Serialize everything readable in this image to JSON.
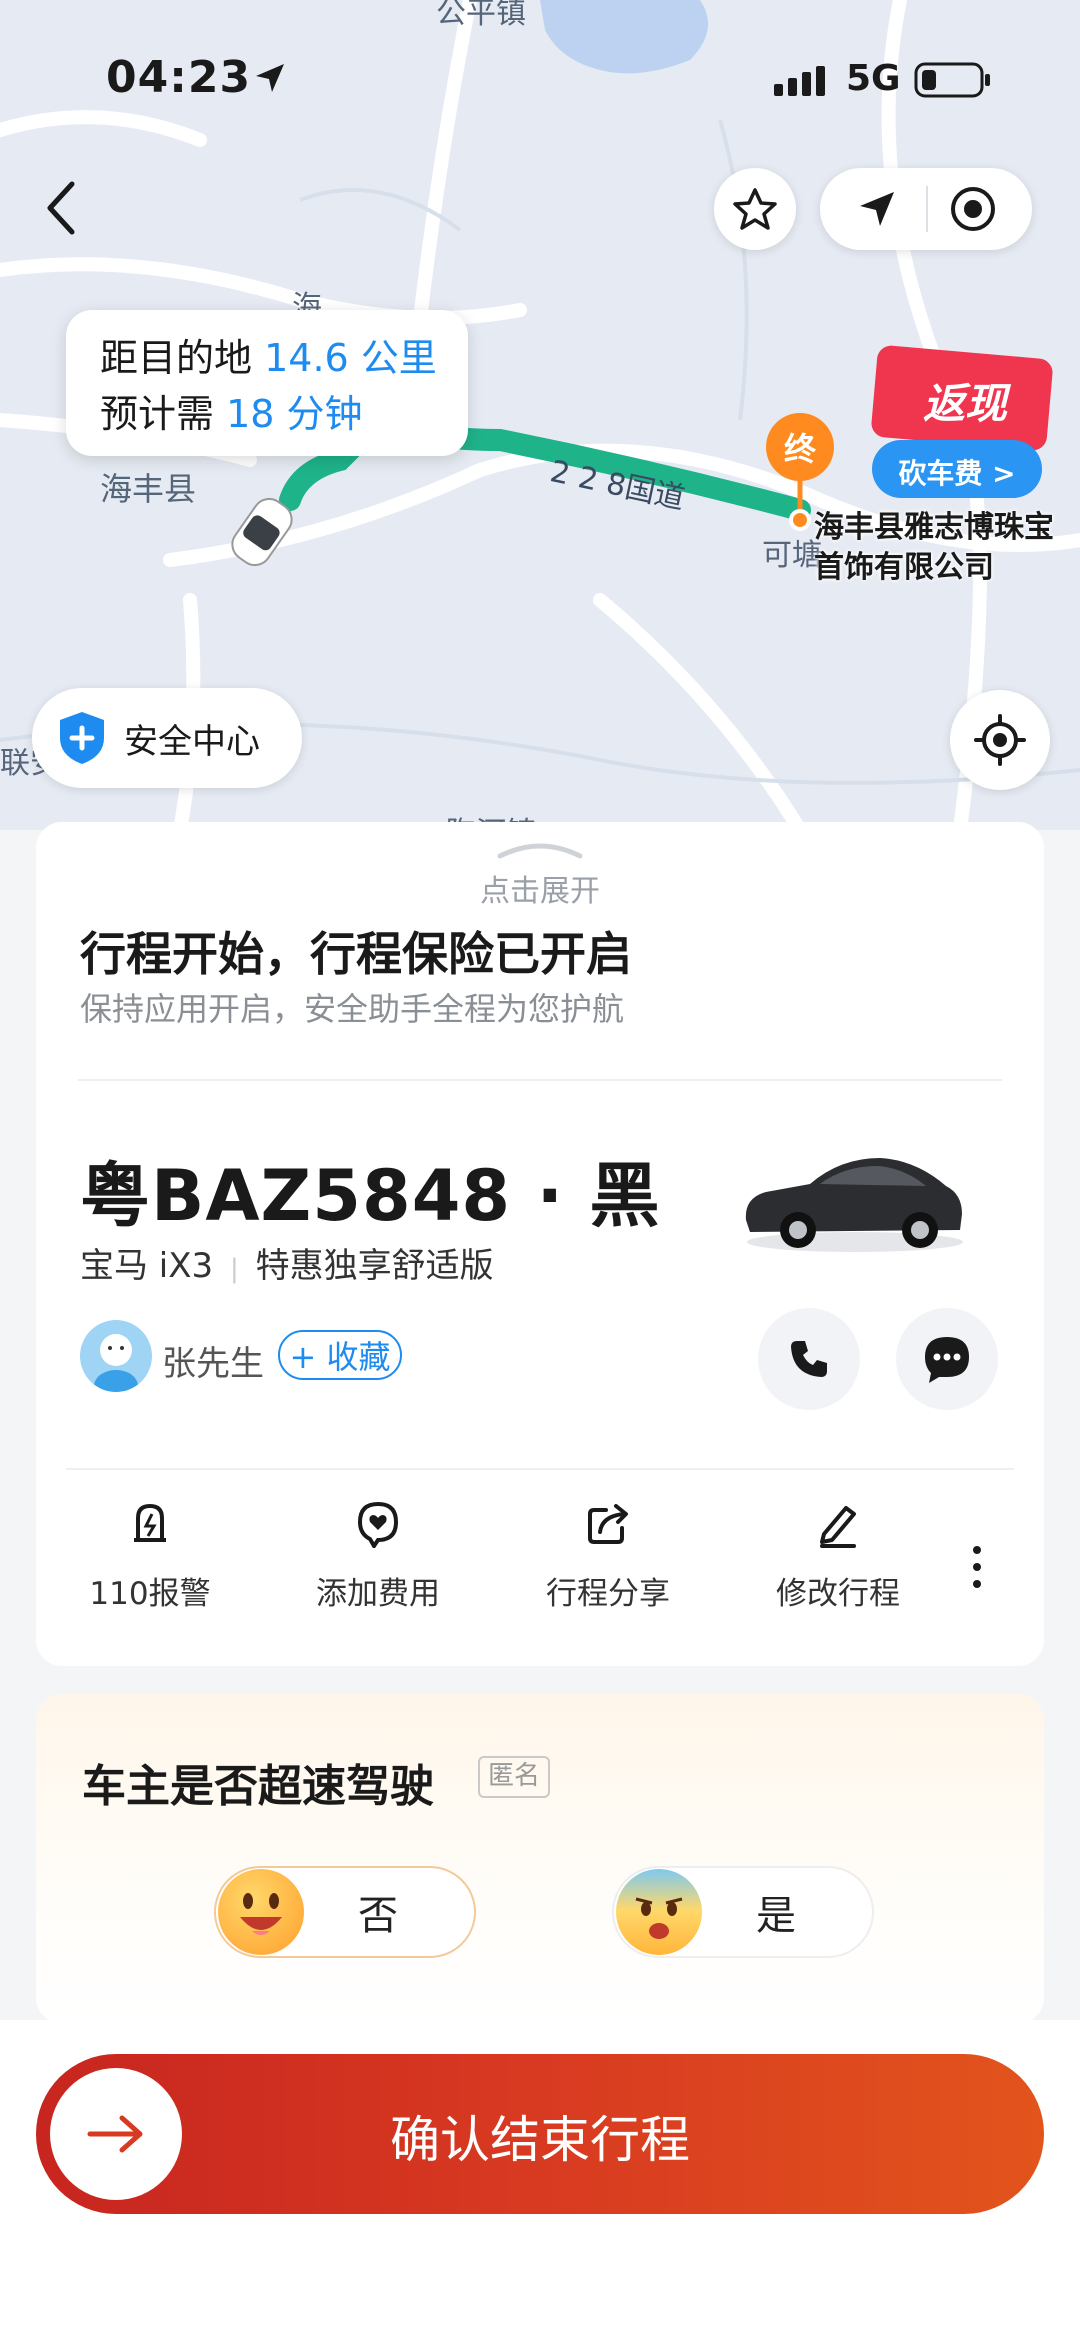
{
  "status_bar": {
    "time": "04:23",
    "network": "5G"
  },
  "map": {
    "distance_prefix": "距目的地",
    "distance_value": "14.6 公里",
    "eta_prefix": "预计需",
    "eta_value": "18 分钟",
    "place_top": "公平镇",
    "place_county": "海丰县",
    "place_road_vertical": "海",
    "road_name": "2 2 8国道",
    "place_keta": "可塘",
    "place_left": "联安",
    "place_bottom": "陶河镇",
    "end_marker": "终",
    "destination": [
      "海丰县雅志博珠宝",
      "首饰有限公司"
    ],
    "promo_title": "返现",
    "promo_sub": "砍车费 >",
    "safety_center": "安全中心"
  },
  "trip": {
    "expand_hint": "点击展开",
    "heading": "行程开始，行程保险已开启",
    "subheading": "保持应用开启，安全助手全程为您护航",
    "plate": "粤BAZ5848 · 黑",
    "car_brand": "宝马 iX3",
    "car_service": "特惠独享舒适版",
    "driver_name": "张先生",
    "favorite_label": "+ 收藏"
  },
  "tools": [
    {
      "label": "110报警",
      "icon": "alarm-icon"
    },
    {
      "label": "添加费用",
      "icon": "add-fee-icon"
    },
    {
      "label": "行程分享",
      "icon": "share-icon"
    },
    {
      "label": "修改行程",
      "icon": "edit-icon"
    }
  ],
  "survey": {
    "question": "车主是否超速驾驶",
    "tag": "匿名",
    "option_no": "否",
    "option_yes": "是"
  },
  "footer": {
    "confirm_label": "确认结束行程"
  },
  "colors": {
    "accent_blue": "#1e8bf0",
    "route_green": "#1fb38a",
    "confirm_red": "#d83a21",
    "end_orange": "#ff8a1f"
  }
}
